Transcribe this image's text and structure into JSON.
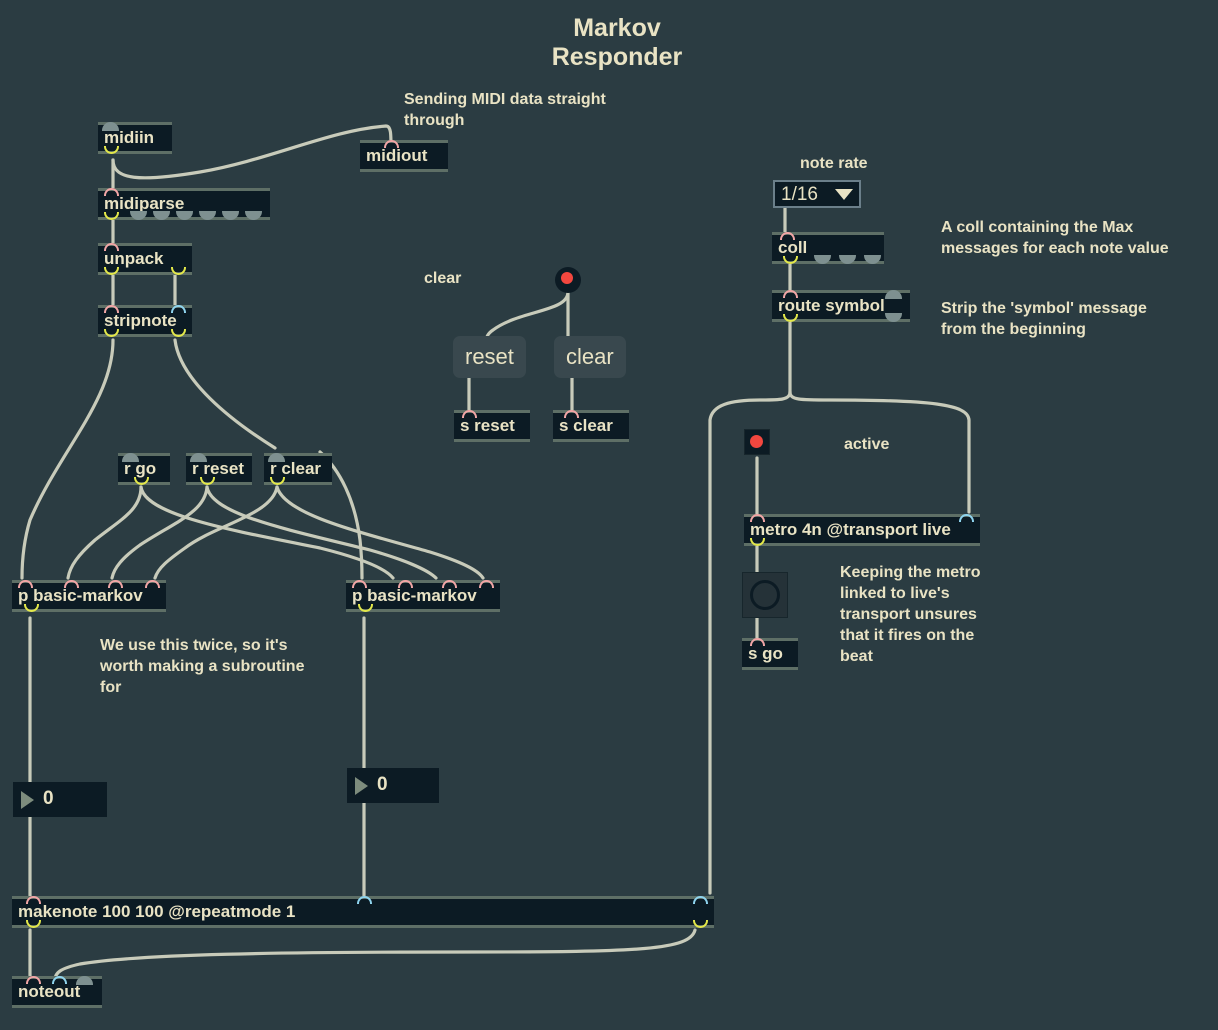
{
  "patch": {
    "title": "Markov\nResponder",
    "background_color": "#2b3c42",
    "text_color": "#e9e3c4",
    "wire_color": "#c8cbba"
  },
  "comments": {
    "midi_through": "Sending MIDI data straight\nthrough",
    "clear_label": "clear",
    "note_rate_label": "note rate",
    "coll_note": "A coll containing the Max\nmessages for each note value",
    "route_note": "Strip the 'symbol' message\nfrom the beginning",
    "active_label": "active",
    "subroutine_note": "We use this twice, so it's\nworth making a subroutine\nfor",
    "metro_note": "Keeping the metro\nlinked to live's\ntransport unsures\nthat it fires on the\nbeat"
  },
  "objects": {
    "midiin": "midiin",
    "midiout": "midiout",
    "midiparse": "midiparse",
    "unpack": "unpack",
    "stripnote": "stripnote",
    "r_go": "r go",
    "r_reset": "r reset",
    "r_clear": "r clear",
    "s_reset": "s reset",
    "s_clear": "s clear",
    "s_go": "s go",
    "p_markov_left": "p basic-markov",
    "p_markov_right": "p basic-markov",
    "coll": "coll",
    "route_symbol": "route symbol",
    "metro": "metro 4n @transport live",
    "makenote": "makenote 100 100 @repeatmode 1",
    "noteout": "noteout"
  },
  "messages": {
    "reset": "reset",
    "clear": "clear"
  },
  "numbers": {
    "left_numbox": "0",
    "right_numbox": "0"
  },
  "umenu": {
    "selected": "1/16",
    "options": [
      "1/16"
    ]
  }
}
